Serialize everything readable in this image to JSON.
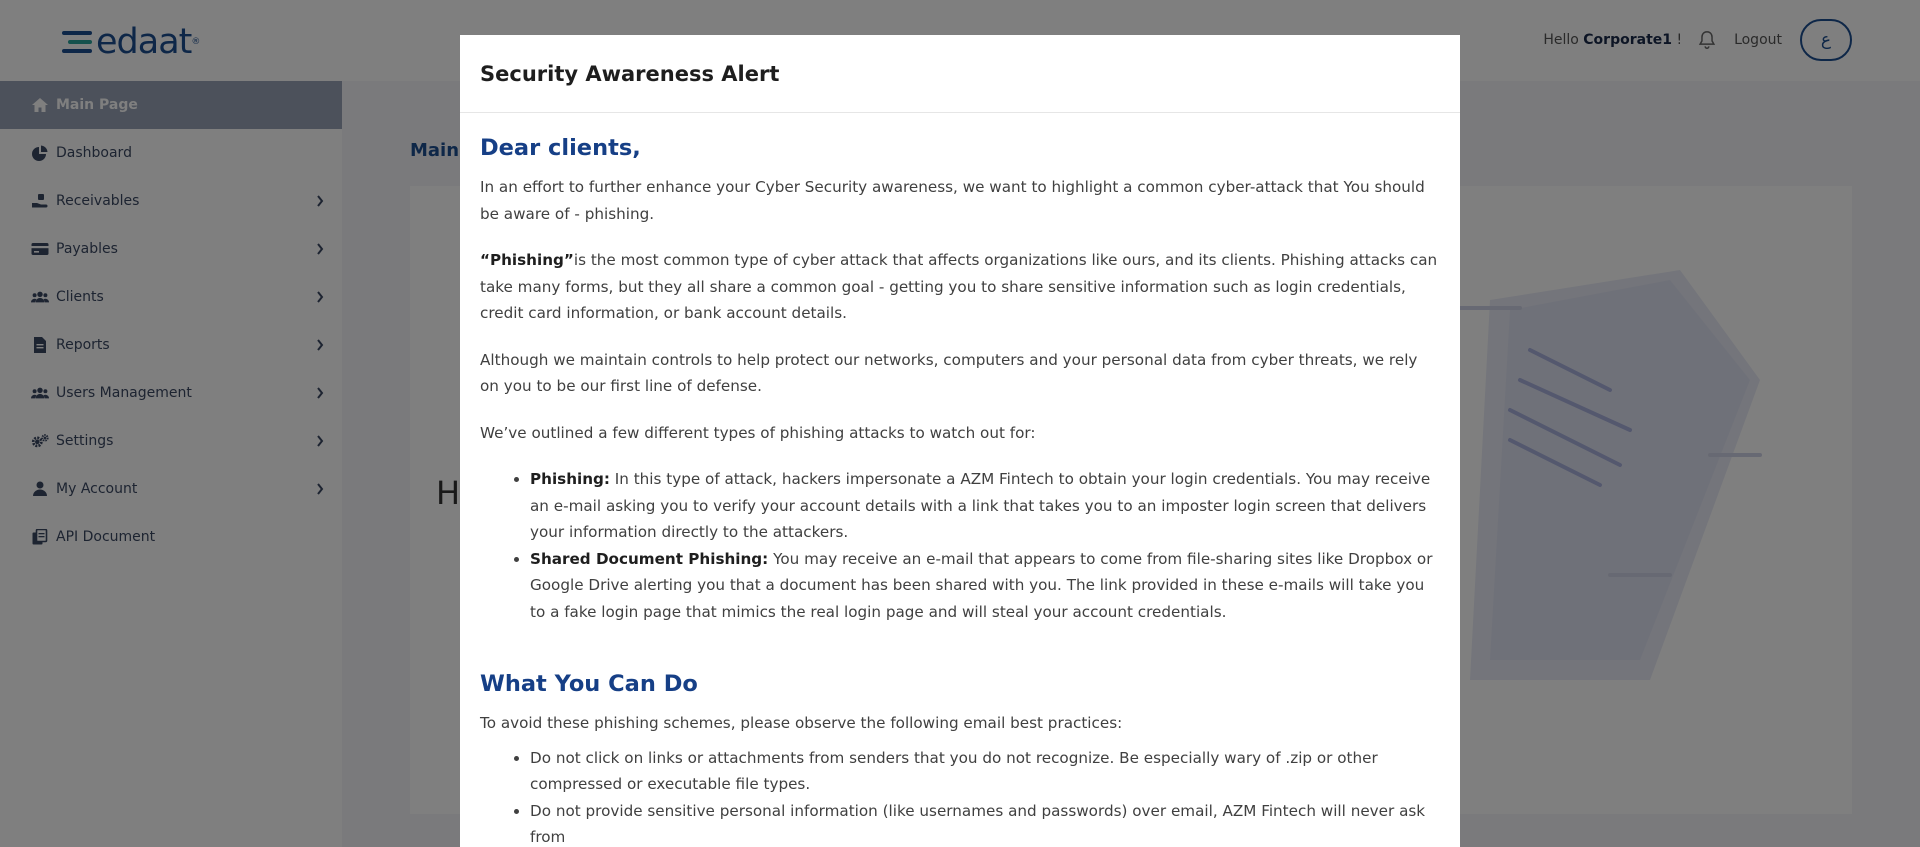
{
  "app": {
    "logo_text": "edaat",
    "logo_tm": "®"
  },
  "header": {
    "hello_prefix": "Hello ",
    "username": "Corporate1",
    "hello_suffix": " !",
    "logout_label": "Logout",
    "avatar_letter": "ع"
  },
  "sidebar": {
    "items": [
      {
        "label": "Main Page",
        "icon": "home-icon"
      },
      {
        "label": "Dashboard",
        "icon": "pie-chart-icon"
      },
      {
        "label": "Receivables",
        "icon": "hand-money-icon"
      },
      {
        "label": "Payables",
        "icon": "credit-card-icon"
      },
      {
        "label": "Clients",
        "icon": "users-icon"
      },
      {
        "label": "Reports",
        "icon": "file-icon"
      },
      {
        "label": "Users Management",
        "icon": "users-icon"
      },
      {
        "label": "Settings",
        "icon": "gears-icon"
      },
      {
        "label": "My Account",
        "icon": "user-icon"
      },
      {
        "label": "API Document",
        "icon": "copy-icon"
      }
    ]
  },
  "main": {
    "title_visible": "Main",
    "card_greeting_visible": "H"
  },
  "modal": {
    "title": "Security Awareness Alert",
    "greeting": "Dear clients,",
    "intro": "In an effort to further enhance your Cyber Security awareness, we want to highlight a common cyber-attack that You should be aware of - phishing.",
    "phishing_term": "“Phishing”",
    "phishing_def": "is the most common type of cyber attack that affects organizations like ours, and its clients. Phishing attacks can take many forms, but they all share a common goal - getting you to share sensitive information such as login credentials, credit card information, or bank account details.",
    "controls": "Although we maintain controls to help protect our networks, computers and your personal data from cyber threats, we rely on you to be our first line of defense.",
    "outlined": "We’ve outlined a few different types of phishing attacks to watch out for:",
    "attack_types": [
      {
        "name": "Phishing:",
        "text": " In this type of attack, hackers impersonate a AZM Fintech to obtain your login credentials. You may receive an e-mail asking you to verify your account details with a link that takes you to an imposter login screen that delivers your information directly to the attackers."
      },
      {
        "name": "Shared Document Phishing:",
        "text": " You may receive an e-mail that appears to come from file-sharing sites like Dropbox or Google Drive alerting you that a document has been shared with you. The link provided in these e-mails will take you to a fake login page that mimics the real login page and will steal your account credentials."
      }
    ],
    "what_heading": "What You Can Do",
    "what_intro": "To avoid these phishing schemes, please observe the following email best practices:",
    "practices": [
      "Do not click on links or attachments from senders that you do not recognize. Be especially wary of .zip or other compressed or executable file types.",
      "Do not provide sensitive personal information (like usernames and passwords) over email, AZM Fintech will never ask from"
    ]
  },
  "colors": {
    "brand_blue": "#1d4f91",
    "brand_teal": "#2aa39b",
    "active_nav": "#99a3b6",
    "heading_blue": "#163f86"
  }
}
